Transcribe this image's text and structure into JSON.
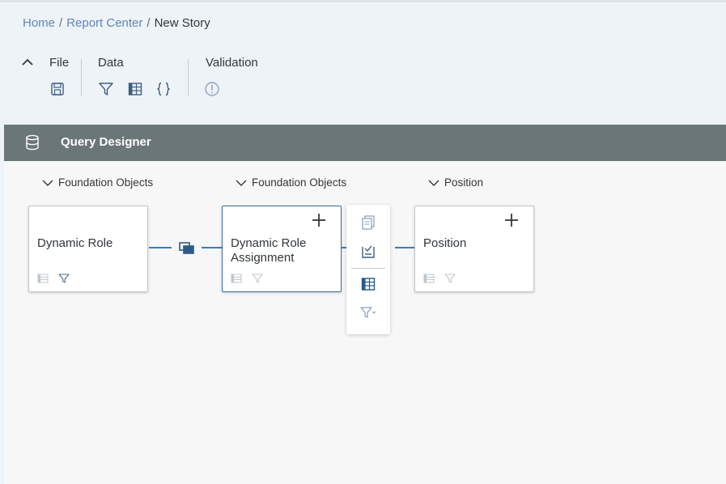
{
  "breadcrumb": {
    "home": "Home",
    "report_center": "Report Center",
    "current": "New Story",
    "separator": "/"
  },
  "toolbar": {
    "file_label": "File",
    "data_label": "Data",
    "validation_label": "Validation",
    "icons": [
      "chevron-up-icon",
      "save-icon",
      "filter-icon",
      "table-icon",
      "braces-icon",
      "exclamation-icon"
    ]
  },
  "query_designer": {
    "title": "Query Designer",
    "icon": "database-icon"
  },
  "sources": [
    {
      "label": "Foundation Objects",
      "node_title": "Dynamic Role"
    },
    {
      "label": "Foundation Objects",
      "node_title": "Dynamic Role Assignment"
    },
    {
      "label": "Position",
      "node_title": "Position"
    }
  ],
  "popover_actions": [
    "copy-icon",
    "select-fields-icon",
    "table-icon",
    "filter-dropdown-icon"
  ],
  "colors": {
    "page_bg": "#eef3f8",
    "bar_bg": "#6b7679",
    "canvas_bg": "#f7f7f7",
    "link": "#5e87b5",
    "connector": "#2f7fc4",
    "icon": "#3f5e7f"
  }
}
